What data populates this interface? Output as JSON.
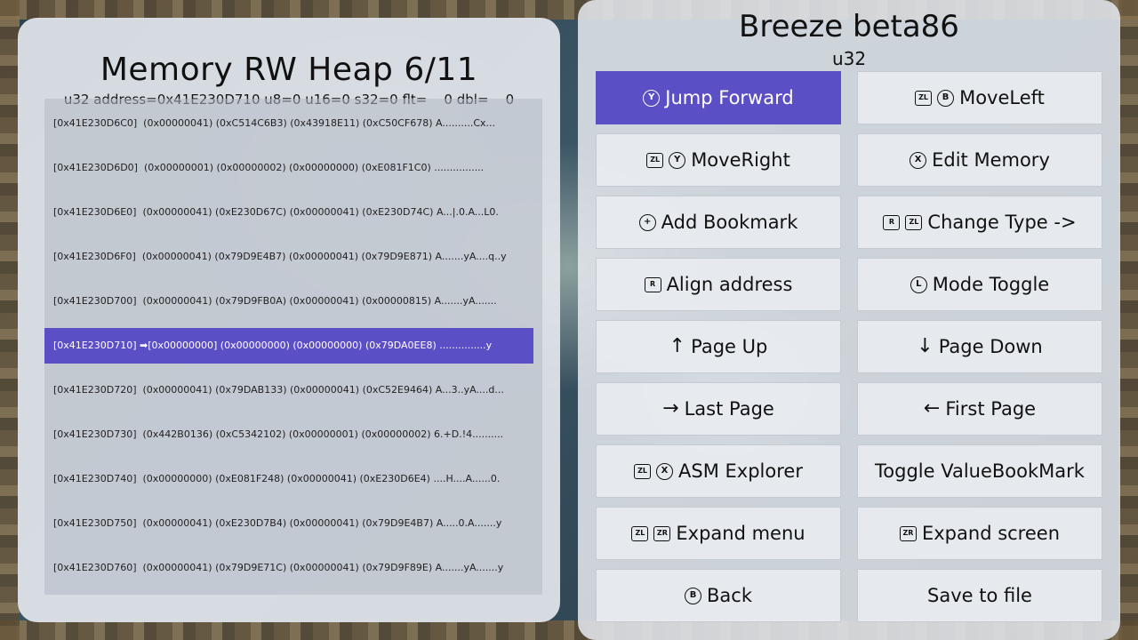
{
  "left": {
    "title": "Memory RW Heap 6/11",
    "status": "u32 address=0x41E230D710 u8=0 u16=0 s32=0 flt=    0 dbl=    0",
    "rows": [
      "[0x41E230D6C0]  (0x00000041) (0xC514C6B3) (0x43918E11) (0xC50CF678) A..........Cx...",
      "[0x41E230D6D0]  (0x00000001) (0x00000002) (0x00000000) (0xE081F1C0) ................",
      "[0x41E230D6E0]  (0x00000041) (0xE230D67C) (0x00000041) (0xE230D74C) A...|.0.A...L0.",
      "[0x41E230D6F0]  (0x00000041) (0x79D9E4B7) (0x00000041) (0x79D9E871) A.......yA....q..y",
      "[0x41E230D700]  (0x00000041) (0x79D9FB0A) (0x00000041) (0x00000815) A.......yA.......",
      "[0x41E230D710] ➡[0x00000000] (0x00000000) (0x00000000) (0x79DA0EE8) ...............y",
      "[0x41E230D720]  (0x00000041) (0x79DAB133) (0x00000041) (0xC52E9464) A...3..yA....d...",
      "[0x41E230D730]  (0x442B0136) (0xC5342102) (0x00000001) (0x00000002) 6.+D.!4..........",
      "[0x41E230D740]  (0x00000000) (0xE081F248) (0x00000041) (0xE230D6E4) ....H....A......0.",
      "[0x41E230D750]  (0x00000041) (0xE230D7B4) (0x00000041) (0x79D9E4B7) A.....0.A.......y",
      "[0x41E230D760]  (0x00000041) (0x79D9E71C) (0x00000041) (0x79D9F89E) A.......yA.......y"
    ],
    "selected_index": 5
  },
  "right": {
    "title": "Breeze beta86",
    "subtitle": "u32",
    "buttons": [
      {
        "label": "Jump Forward",
        "icons": [
          "Y"
        ],
        "icon_names": [
          "y-button-icon"
        ],
        "active": true
      },
      {
        "label": "MoveLeft",
        "icons": [
          "ZL",
          "B"
        ],
        "icon_names": [
          "zl-button-icon",
          "b-button-icon"
        ]
      },
      {
        "label": "MoveRight",
        "icons": [
          "ZL",
          "Y"
        ],
        "icon_names": [
          "zl-button-icon",
          "y-button-icon"
        ]
      },
      {
        "label": "Edit Memory",
        "icons": [
          "X"
        ],
        "icon_names": [
          "x-button-icon"
        ]
      },
      {
        "label": "Add Bookmark",
        "icons": [
          "+"
        ],
        "icon_names": [
          "plus-button-icon"
        ]
      },
      {
        "label": "Change Type ->",
        "icons": [
          "R",
          "ZL"
        ],
        "icon_names": [
          "r-button-icon",
          "zl-button-icon"
        ]
      },
      {
        "label": "Align address",
        "icons": [
          "R"
        ],
        "icon_names": [
          "r-button-icon"
        ]
      },
      {
        "label": "Mode Toggle",
        "icons": [
          "L"
        ],
        "icon_names": [
          "left-stick-button-icon"
        ]
      },
      {
        "label": "Page Up",
        "icons": [
          "↑"
        ],
        "icon_names": [
          "arrow-up-icon"
        ]
      },
      {
        "label": "Page Down",
        "icons": [
          "↓"
        ],
        "icon_names": [
          "arrow-down-icon"
        ]
      },
      {
        "label": "Last Page",
        "icons": [
          "→"
        ],
        "icon_names": [
          "arrow-right-icon"
        ]
      },
      {
        "label": "First Page",
        "icons": [
          "←"
        ],
        "icon_names": [
          "arrow-left-icon"
        ]
      },
      {
        "label": "ASM Explorer",
        "icons": [
          "ZL",
          "X"
        ],
        "icon_names": [
          "zl-button-icon",
          "x-button-icon"
        ]
      },
      {
        "label": "Toggle ValueBookMark",
        "icons": [],
        "icon_names": []
      },
      {
        "label": "Expand menu",
        "icons": [
          "ZL",
          "ZR"
        ],
        "icon_names": [
          "zl-button-icon",
          "zr-button-icon"
        ]
      },
      {
        "label": "Expand screen",
        "icons": [
          "ZR"
        ],
        "icon_names": [
          "zr-button-icon"
        ]
      },
      {
        "label": "Back",
        "icons": [
          "B"
        ],
        "icon_names": [
          "b-button-icon"
        ]
      },
      {
        "label": "Save to file",
        "icons": [],
        "icon_names": []
      }
    ]
  },
  "colors": {
    "accent": "#5b4fc6",
    "panel": "#e2e6ec"
  }
}
